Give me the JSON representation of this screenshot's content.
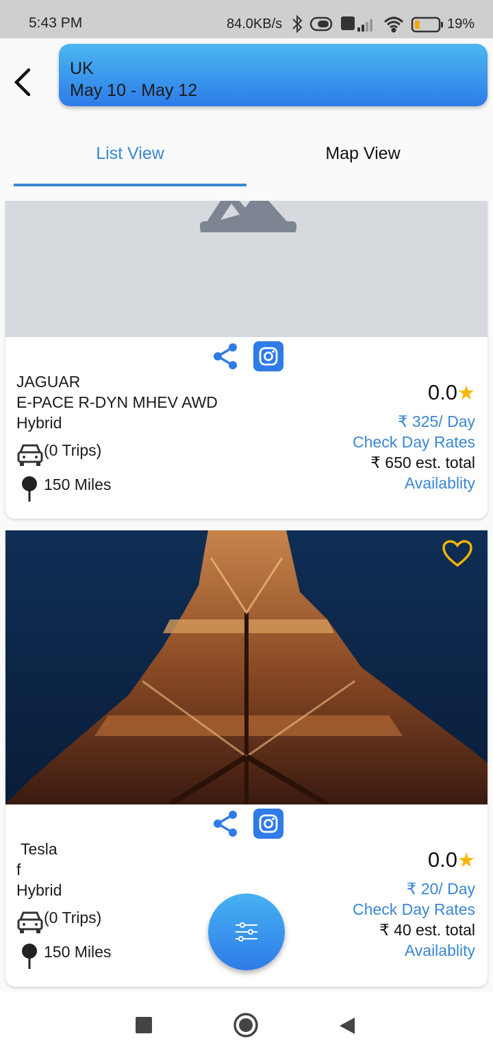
{
  "status_bar": {
    "time": "5:43 PM",
    "speed": "84.0KB/s",
    "battery": "19%",
    "icons": [
      "bluetooth-icon",
      "vibrate-icon",
      "volte-icon",
      "signal-icon",
      "wifi-icon",
      "battery-icon"
    ]
  },
  "header": {
    "location": "UK",
    "dates": "May 10 - May 12"
  },
  "tabs": [
    {
      "label": "List View",
      "active": true
    },
    {
      "label": "Map View",
      "active": false
    }
  ],
  "cars": [
    {
      "make": "JAGUAR",
      "model": "E-PACE R-DYN MHEV AWD",
      "fuel": "Hybrid",
      "trips": "(0 Trips)",
      "distance": "150 Miles",
      "rating": "0.0",
      "price_per_day": "₹ 325/ Day",
      "check_rates": "Check Day Rates",
      "est_total": "₹ 650 est. total",
      "availability": "Availablity",
      "image": "image-placeholder"
    },
    {
      "make": " Tesla",
      "model": "f",
      "fuel": "Hybrid",
      "trips": "(0 Trips)",
      "distance": "150 Miles",
      "rating": "0.0",
      "price_per_day": "₹ 20/ Day",
      "check_rates": "Check Day Rates",
      "est_total": "₹ 40 est. total",
      "availability": "Availablity",
      "image": "eiffel-tower-photo"
    }
  ],
  "colors": {
    "accent": "#3a86d4",
    "star": "#f7b500",
    "header_gradient_top": "#4bb7f0",
    "header_gradient_bottom": "#2d7ce8"
  }
}
